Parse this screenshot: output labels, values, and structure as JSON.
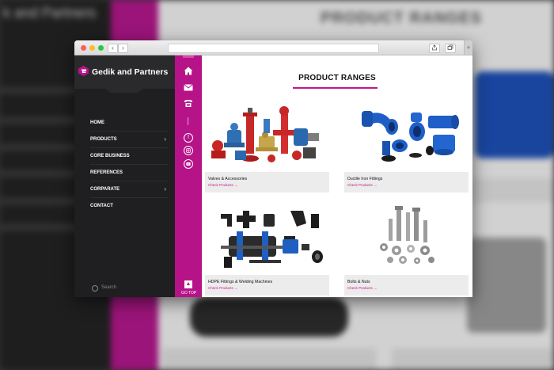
{
  "background": {
    "brand_text": "k and Partners",
    "page_title": "PRODUCT RANGES"
  },
  "browser": {
    "back": "‹",
    "forward": "›",
    "share_icon": "share-icon",
    "tabs_icon": "tabs-icon",
    "new_tab": "+"
  },
  "sidebar": {
    "brand": "Gedik and Partners",
    "menu": [
      {
        "label": "HOME",
        "has_children": false
      },
      {
        "label": "PRODUCTS",
        "has_children": true
      },
      {
        "label": "CORE BUSINESS",
        "has_children": false
      },
      {
        "label": "REFERENCES",
        "has_children": false
      },
      {
        "label": "CORPARATE",
        "has_children": true
      },
      {
        "label": "CONTACT",
        "has_children": false
      }
    ],
    "search_placeholder": "Search"
  },
  "side_bar": {
    "icons": [
      "home-icon",
      "mail-icon",
      "phone-icon",
      "facebook-icon",
      "instagram-icon",
      "youtube-icon"
    ],
    "go_top": "GO TOP"
  },
  "main": {
    "title": "PRODUCT RANGES",
    "products": [
      {
        "name": "Valves & Accessories",
        "link": "Check Products →"
      },
      {
        "name": "Ductile Iron Fittings",
        "link": "Check Products →"
      },
      {
        "name": "HDPE Fittings & Welding Machines",
        "link": "Check Products →"
      },
      {
        "name": "Bolts & Nuts",
        "link": "Check Products →"
      }
    ]
  },
  "colors": {
    "accent": "#b61389",
    "sidebar": "#1f1f21",
    "blue_product": "#1e5ec8"
  }
}
